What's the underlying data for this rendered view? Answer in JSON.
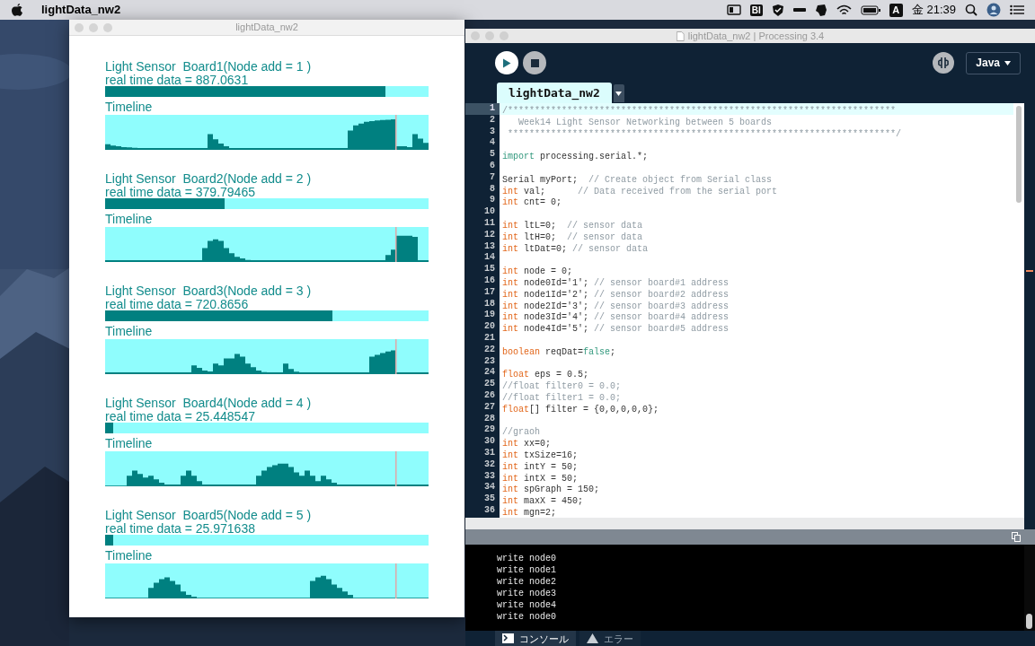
{
  "menu_bar": {
    "app_name": "lightData_nw2",
    "status_labels": [
      "BI",
      "A"
    ],
    "clock": "金 21:39"
  },
  "sketch_window": {
    "title": "lightData_nw2",
    "boards": [
      {
        "title": "Light Sensor  Board1(Node add = 1 )",
        "reading": "real time data = 887.0631",
        "level": 0.867,
        "timeline_label": "Timeline"
      },
      {
        "title": "Light Sensor  Board2(Node add = 2 )",
        "reading": "real time data = 379.79465",
        "level": 0.37,
        "timeline_label": "Timeline"
      },
      {
        "title": "Light Sensor  Board3(Node add = 3 )",
        "reading": "real time data = 720.8656",
        "level": 0.703,
        "timeline_label": "Timeline"
      },
      {
        "title": "Light Sensor  Board4(Node add = 4 )",
        "reading": "real time data = 25.448547",
        "level": 0.024,
        "timeline_label": "Timeline"
      },
      {
        "title": "Light Sensor  Board5(Node add = 5 )",
        "reading": "real time data = 25.971638",
        "level": 0.025,
        "timeline_label": "Timeline"
      }
    ]
  },
  "ide_window": {
    "title": "lightData_nw2 | Processing 3.4",
    "mode": "Java",
    "tabs": [
      {
        "label": "lightData_nw2",
        "selected": true
      }
    ],
    "code_lines": [
      {
        "number": "1",
        "current": true,
        "segments": [
          {
            "kind": "comment",
            "text": "/************************************************************************"
          }
        ]
      },
      {
        "number": "2",
        "current": false,
        "segments": [
          {
            "kind": "comment",
            "text": "   Week14 Light Sensor Networking between 5 boards"
          }
        ]
      },
      {
        "number": "3",
        "current": false,
        "segments": [
          {
            "kind": "comment",
            "text": " ************************************************************************/"
          }
        ]
      },
      {
        "number": "4",
        "current": false
      },
      {
        "number": "5",
        "current": false,
        "segments": [
          {
            "kind": "keyword",
            "text": "import"
          },
          {
            "kind": "plain",
            "text": " processing.serial.*;"
          }
        ]
      },
      {
        "number": "6",
        "current": false
      },
      {
        "number": "7",
        "current": false,
        "segments": [
          {
            "kind": "plain",
            "text": "Serial myPort;  "
          },
          {
            "kind": "comment",
            "text": "// Create object from Serial class"
          }
        ]
      },
      {
        "number": "8",
        "current": false,
        "segments": [
          {
            "kind": "type",
            "text": "int"
          },
          {
            "kind": "plain",
            "text": " val;      "
          },
          {
            "kind": "comment",
            "text": "// Data received from the serial port"
          }
        ]
      },
      {
        "number": "9",
        "current": false,
        "segments": [
          {
            "kind": "type",
            "text": "int"
          },
          {
            "kind": "plain",
            "text": " cnt= 0;"
          }
        ]
      },
      {
        "number": "10",
        "current": false
      },
      {
        "number": "11",
        "current": false,
        "segments": [
          {
            "kind": "type",
            "text": "int"
          },
          {
            "kind": "plain",
            "text": " ltL=0;  "
          },
          {
            "kind": "comment",
            "text": "// sensor data"
          }
        ]
      },
      {
        "number": "12",
        "current": false,
        "segments": [
          {
            "kind": "type",
            "text": "int"
          },
          {
            "kind": "plain",
            "text": " ltH=0;  "
          },
          {
            "kind": "comment",
            "text": "// sensor data"
          }
        ]
      },
      {
        "number": "13",
        "current": false,
        "segments": [
          {
            "kind": "type",
            "text": "int"
          },
          {
            "kind": "plain",
            "text": " ltDat=0; "
          },
          {
            "kind": "comment",
            "text": "// sensor data"
          }
        ]
      },
      {
        "number": "14",
        "current": false
      },
      {
        "number": "15",
        "current": false,
        "segments": [
          {
            "kind": "type",
            "text": "int"
          },
          {
            "kind": "plain",
            "text": " node = 0;"
          }
        ]
      },
      {
        "number": "16",
        "current": false,
        "segments": [
          {
            "kind": "type",
            "text": "int"
          },
          {
            "kind": "plain",
            "text": " node0Id='1'; "
          },
          {
            "kind": "comment",
            "text": "// sensor board#1 address"
          }
        ]
      },
      {
        "number": "17",
        "current": false,
        "segments": [
          {
            "kind": "type",
            "text": "int"
          },
          {
            "kind": "plain",
            "text": " node1Id='2'; "
          },
          {
            "kind": "comment",
            "text": "// sensor board#2 address"
          }
        ]
      },
      {
        "number": "18",
        "current": false,
        "segments": [
          {
            "kind": "type",
            "text": "int"
          },
          {
            "kind": "plain",
            "text": " node2Id='3'; "
          },
          {
            "kind": "comment",
            "text": "// sensor board#3 address"
          }
        ]
      },
      {
        "number": "19",
        "current": false,
        "segments": [
          {
            "kind": "type",
            "text": "int"
          },
          {
            "kind": "plain",
            "text": " node3Id='4'; "
          },
          {
            "kind": "comment",
            "text": "// sensor board#4 address"
          }
        ]
      },
      {
        "number": "20",
        "current": false,
        "segments": [
          {
            "kind": "type",
            "text": "int"
          },
          {
            "kind": "plain",
            "text": " node4Id='5'; "
          },
          {
            "kind": "comment",
            "text": "// sensor board#5 address"
          }
        ]
      },
      {
        "number": "21",
        "current": false
      },
      {
        "number": "22",
        "current": false,
        "segments": [
          {
            "kind": "type",
            "text": "boolean"
          },
          {
            "kind": "plain",
            "text": " reqDat="
          },
          {
            "kind": "keyword",
            "text": "false"
          },
          {
            "kind": "plain",
            "text": ";"
          }
        ]
      },
      {
        "number": "23",
        "current": false
      },
      {
        "number": "24",
        "current": false,
        "segments": [
          {
            "kind": "type",
            "text": "float"
          },
          {
            "kind": "plain",
            "text": " eps = 0.5;"
          }
        ]
      },
      {
        "number": "25",
        "current": false,
        "segments": [
          {
            "kind": "comment",
            "text": "//float filter0 = 0.0;"
          }
        ]
      },
      {
        "number": "26",
        "current": false,
        "segments": [
          {
            "kind": "comment",
            "text": "//float filter1 = 0.0;"
          }
        ]
      },
      {
        "number": "27",
        "current": false,
        "segments": [
          {
            "kind": "type",
            "text": "float"
          },
          {
            "kind": "plain",
            "text": "[] filter = {0,0,0,0,0};"
          }
        ]
      },
      {
        "number": "28",
        "current": false
      },
      {
        "number": "29",
        "current": false,
        "segments": [
          {
            "kind": "comment",
            "text": "//graoh"
          }
        ]
      },
      {
        "number": "30",
        "current": false,
        "segments": [
          {
            "kind": "type",
            "text": "int"
          },
          {
            "kind": "plain",
            "text": " xx=0;"
          }
        ]
      },
      {
        "number": "31",
        "current": false,
        "segments": [
          {
            "kind": "type",
            "text": "int"
          },
          {
            "kind": "plain",
            "text": " txSize=16;"
          }
        ]
      },
      {
        "number": "32",
        "current": false,
        "segments": [
          {
            "kind": "type",
            "text": "int"
          },
          {
            "kind": "plain",
            "text": " intY = 50;"
          }
        ]
      },
      {
        "number": "33",
        "current": false,
        "segments": [
          {
            "kind": "type",
            "text": "int"
          },
          {
            "kind": "plain",
            "text": " intX = 50;"
          }
        ]
      },
      {
        "number": "34",
        "current": false,
        "segments": [
          {
            "kind": "type",
            "text": "int"
          },
          {
            "kind": "plain",
            "text": " spGraph = 150;"
          }
        ]
      },
      {
        "number": "35",
        "current": false,
        "segments": [
          {
            "kind": "type",
            "text": "int"
          },
          {
            "kind": "plain",
            "text": " maxX = 450;"
          }
        ]
      },
      {
        "number": "36",
        "current": false,
        "segments": [
          {
            "kind": "type",
            "text": "int"
          },
          {
            "kind": "plain",
            "text": " mgn=2;"
          }
        ]
      }
    ],
    "console_lines": [
      "write node0",
      "write node1",
      "write node2",
      "write node3",
      "write node4",
      "write node0"
    ],
    "bottom_tabs": [
      {
        "label": "コンソール",
        "selected": true
      },
      {
        "label": "エラー",
        "selected": false
      }
    ]
  }
}
